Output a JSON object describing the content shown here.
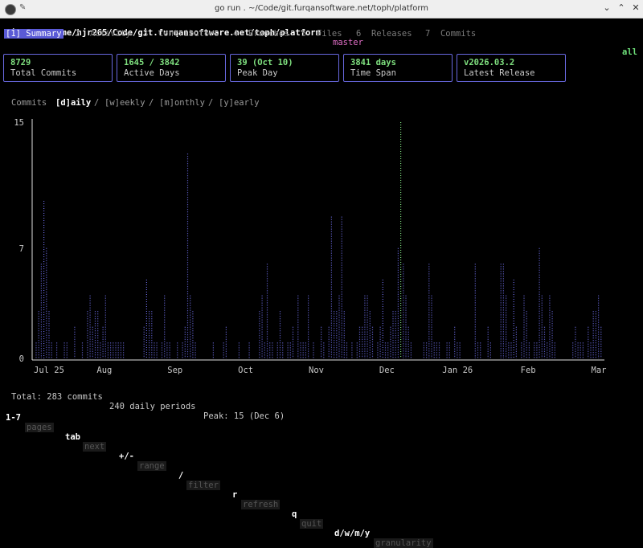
{
  "window": {
    "title": "go run . ~/Code/git.furqansoftware.net/toph/platform"
  },
  "header": {
    "path": "gittop: /home/hjr265/Code/git.furqansoftware.net/toph/platform",
    "branch": "master",
    "scope": "all"
  },
  "tabs": [
    {
      "label": "[1] Summary",
      "active": true
    },
    {
      "label": "2  Activity",
      "active": false
    },
    {
      "label": "3  Contributors",
      "active": false
    },
    {
      "label": "4  Branches",
      "active": false
    },
    {
      "label": "5  Files",
      "active": false
    },
    {
      "label": "6  Releases",
      "active": false
    },
    {
      "label": "7  Commits",
      "active": false
    }
  ],
  "cards": [
    {
      "value": "8729",
      "label": "Total Commits"
    },
    {
      "value": "1645 / 3842",
      "label": "Active Days"
    },
    {
      "value": "39 (Oct 10)",
      "label": "Peak Day"
    },
    {
      "value": "3841 days",
      "label": "Time Span"
    },
    {
      "value": "v2026.03.2",
      "label": "Latest Release"
    }
  ],
  "granularity": {
    "title": "Commits",
    "options": [
      "[d]aily",
      "[w]eekly",
      "[m]onthly",
      "[y]early"
    ],
    "separator": "/",
    "active": 0
  },
  "chart_data": {
    "type": "bar",
    "y_ticks": [
      "15",
      "7",
      "0"
    ],
    "ylim": [
      0,
      15
    ],
    "x_labels": [
      "Jul 25",
      "Aug",
      "Sep",
      "Oct",
      "Nov",
      "Dec",
      "Jan 26",
      "Feb",
      "Mar"
    ],
    "bar_color": "#6a6ae0",
    "peak_color": "#7fe07f",
    "values": [
      1,
      3,
      6,
      10,
      7,
      3,
      1,
      0,
      1,
      0,
      0,
      1,
      1,
      0,
      0,
      2,
      0,
      0,
      1,
      0,
      3,
      4,
      2,
      3,
      3,
      1,
      2,
      4,
      1,
      1,
      1,
      1,
      1,
      1,
      1,
      0,
      0,
      0,
      0,
      0,
      0,
      0,
      2,
      5,
      3,
      3,
      1,
      1,
      0,
      1,
      4,
      1,
      1,
      0,
      0,
      1,
      0,
      1,
      2,
      13,
      4,
      3,
      1,
      0,
      0,
      0,
      0,
      0,
      0,
      1,
      0,
      0,
      0,
      1,
      2,
      0,
      0,
      0,
      0,
      1,
      0,
      0,
      0,
      1,
      0,
      0,
      0,
      3,
      4,
      1,
      6,
      1,
      1,
      0,
      1,
      3,
      1,
      0,
      1,
      1,
      2,
      0,
      4,
      1,
      1,
      1,
      4,
      0,
      1,
      0,
      0,
      2,
      1,
      0,
      2,
      9,
      3,
      3,
      4,
      9,
      3,
      1,
      0,
      1,
      0,
      1,
      2,
      2,
      4,
      4,
      3,
      2,
      0,
      1,
      2,
      5,
      1,
      1,
      2,
      3,
      3,
      7,
      15,
      6,
      4,
      2,
      1,
      0,
      0,
      0,
      0,
      1,
      1,
      6,
      4,
      1,
      1,
      1,
      0,
      0,
      1,
      1,
      0,
      2,
      1,
      1,
      0,
      0,
      0,
      0,
      0,
      6,
      1,
      1,
      0,
      0,
      2,
      1,
      0,
      0,
      0,
      6,
      6,
      4,
      1,
      1,
      5,
      2,
      0,
      1,
      4,
      3,
      1,
      0,
      1,
      1,
      7,
      4,
      2,
      1,
      4,
      3,
      1,
      0,
      0,
      0,
      0,
      0,
      0,
      1,
      2,
      1,
      1,
      1,
      0,
      2,
      1,
      3,
      3,
      4,
      2
    ],
    "summary": {
      "total": "Total: 283 commits",
      "periods": "240 daily periods",
      "peak": "Peak: 15 (Dec 6)"
    }
  },
  "footer": [
    {
      "key": "1-7",
      "desc": "pages"
    },
    {
      "key": "tab",
      "desc": "next"
    },
    {
      "key": "+/-",
      "desc": "range"
    },
    {
      "key": "/",
      "desc": "filter"
    },
    {
      "key": "r",
      "desc": "refresh"
    },
    {
      "key": "q",
      "desc": "quit"
    },
    {
      "key": "d/w/m/y",
      "desc": "granularity"
    }
  ]
}
